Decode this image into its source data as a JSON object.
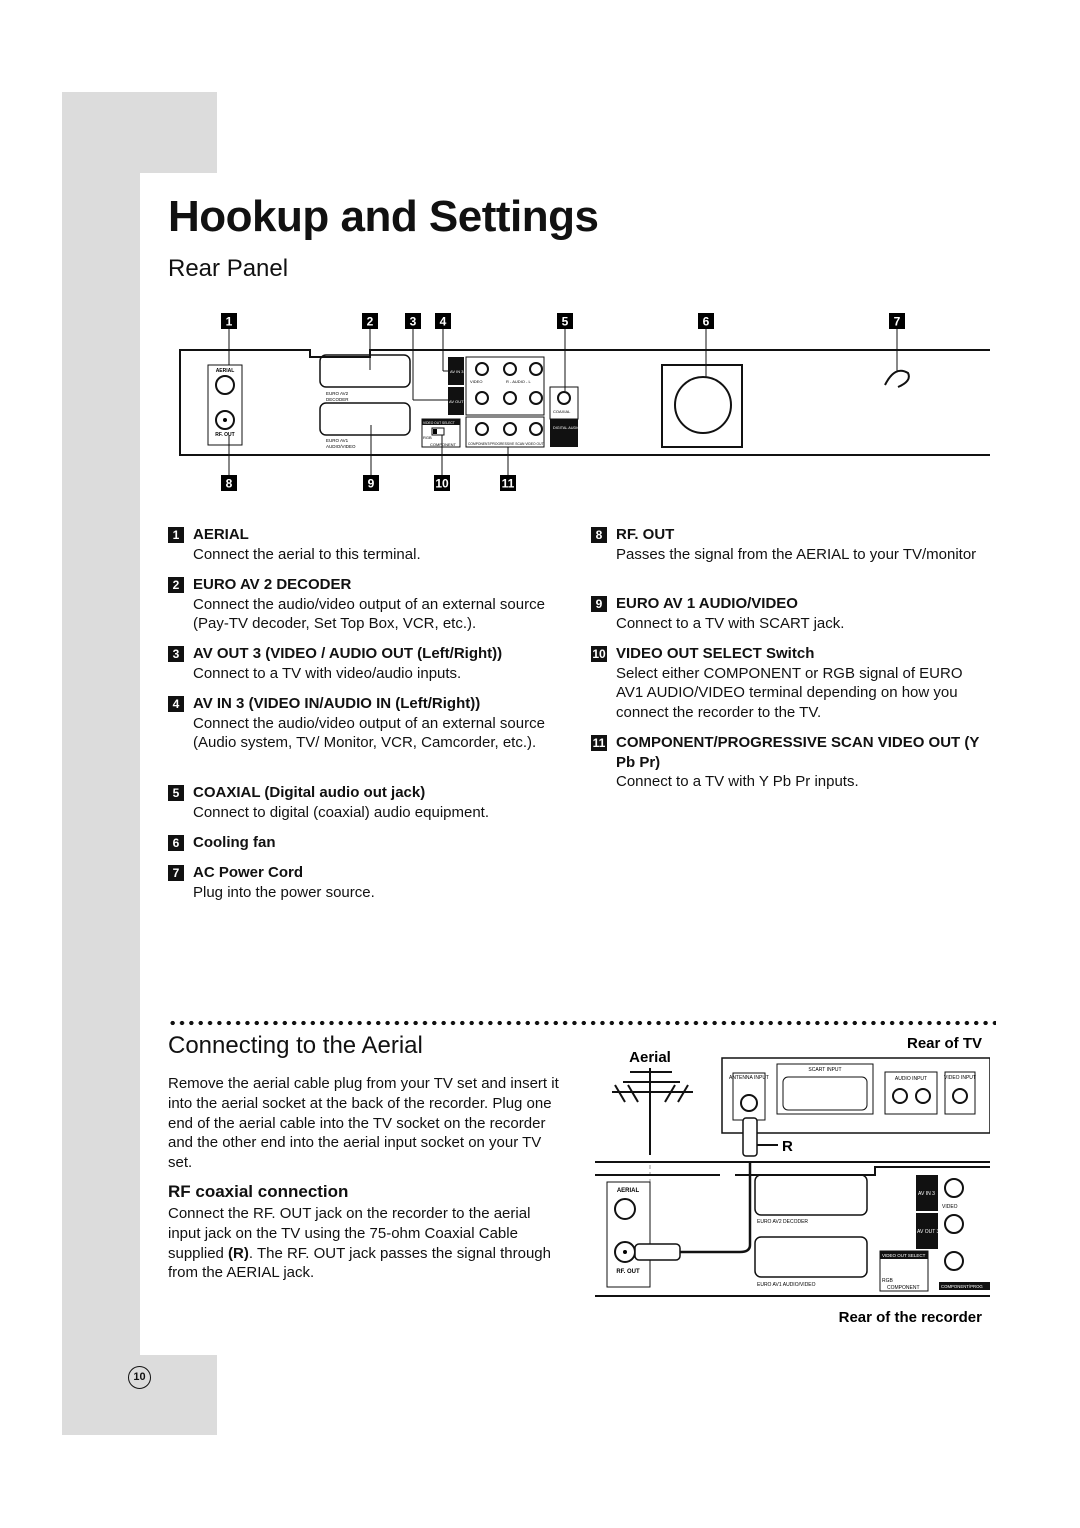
{
  "title": "Hookup and Settings",
  "rear_panel": {
    "heading": "Rear Panel",
    "callouts_top": [
      "1",
      "2",
      "3",
      "4",
      "5",
      "6",
      "7"
    ],
    "callouts_bottom": [
      "8",
      "9",
      "10",
      "11"
    ],
    "panel_labels": {
      "aerial": "AERIAL",
      "rf_out": "RF. OUT",
      "euro_av2": "EURO AV2",
      "decoder": "DECODER",
      "euro_av1": "EURO AV1",
      "audio_video": "AUDIO/VIDEO",
      "av_in3": "AV IN 3",
      "av_out3": "AV OUT 3",
      "video": "VIDEO",
      "audio_lr": "R - AUDIO - L",
      "coaxial": "COAXIAL",
      "digital_audio_out": "DIGITAL AUDIO OUT",
      "video_out_select": "VIDEO OUT SELECT",
      "rgb": "RGB",
      "component": "COMPONENT",
      "component_scan": "COMPONENT/PROGRESSIVE SCAN VIDEO OUT",
      "y": "Y",
      "pb": "Pb",
      "pr": "Pr"
    },
    "items_left": [
      {
        "n": "1",
        "title": "AERIAL",
        "desc": "Connect the aerial to this terminal."
      },
      {
        "n": "2",
        "title": "EURO AV 2 DECODER",
        "desc": "Connect the audio/video output of an external source (Pay-TV decoder, Set Top Box, VCR, etc.)."
      },
      {
        "n": "3",
        "title": "AV OUT 3 (VIDEO / AUDIO OUT (Left/Right))",
        "desc": "Connect to a TV with video/audio inputs."
      },
      {
        "n": "4",
        "title": "AV IN 3 (VIDEO IN/AUDIO IN (Left/Right))",
        "desc": "Connect the audio/video output of an external source (Audio system, TV/ Monitor, VCR, Camcorder, etc.)."
      },
      {
        "n": "5",
        "title": "COAXIAL (Digital audio out jack)",
        "desc": "Connect to digital (coaxial) audio equipment."
      },
      {
        "n": "6",
        "title": "Cooling fan",
        "desc": ""
      },
      {
        "n": "7",
        "title": "AC Power Cord",
        "desc": "Plug into the power source."
      }
    ],
    "items_right": [
      {
        "n": "8",
        "title": "RF. OUT",
        "desc": "Passes the signal from the AERIAL to your TV/monitor"
      },
      {
        "n": "9",
        "title": "EURO AV 1 AUDIO/VIDEO",
        "desc": "Connect to a TV with SCART jack."
      },
      {
        "n": "10",
        "title": "VIDEO OUT SELECT Switch",
        "desc": "Select either COMPONENT or RGB signal of EURO AV1 AUDIO/VIDEO terminal depending on how you connect the recorder to the TV."
      },
      {
        "n": "11",
        "title": "COMPONENT/PROGRESSIVE SCAN VIDEO OUT (Y Pb Pr)",
        "desc": "Connect to a TV with Y Pb Pr inputs."
      }
    ]
  },
  "aerial": {
    "heading": "Connecting to the Aerial",
    "intro": "Remove the aerial cable plug from your TV set and insert it into the aerial socket at the back of the recorder. Plug one end of the aerial cable into the TV socket on the recorder and the other end into the aerial input socket on your TV set.",
    "sub_heading": "RF coaxial connection",
    "body_pre": "Connect the RF. OUT jack on the recorder to the aerial input jack on the TV using the 75-ohm Coaxial Cable supplied ",
    "body_bold": "(R)",
    "body_post": ". The RF. OUT jack passes the signal through from the AERIAL jack.",
    "diagram": {
      "aerial_label": "Aerial",
      "rear_tv": "Rear of TV",
      "rear_recorder": "Rear of the recorder",
      "r_label": "R",
      "antenna_input": "ANTENNA INPUT",
      "scart_input": "SCART INPUT",
      "audio_input": "AUDIO INPUT",
      "video_input": "VIDEO INPUT",
      "aerial": "AERIAL",
      "rf_out": "RF. OUT",
      "euro_av2": "EURO AV2 DECODER",
      "euro_av1": "EURO AV1 AUDIO/VIDEO",
      "av_in3": "AV IN 3",
      "av_out3": "AV OUT 3",
      "video": "VIDEO",
      "video_out_select": "VIDEO OUT SELECT",
      "rgb": "RGB",
      "component": "COMPONENT",
      "component_prog": "COMPONENT/PROG"
    }
  },
  "page_number": "10"
}
